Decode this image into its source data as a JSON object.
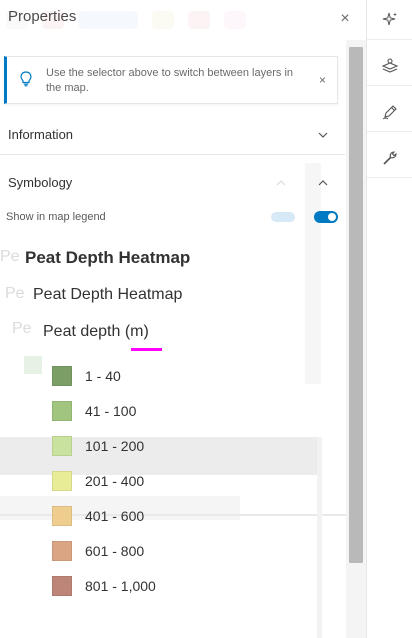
{
  "panel": {
    "title": "Properties",
    "close_glyph": "×"
  },
  "notice": {
    "icon": "lightbulb-icon",
    "text": "Use the selector above to switch between layers in the map.",
    "close_glyph": "×"
  },
  "sections": {
    "information": {
      "label": "Information",
      "state": "collapsed"
    },
    "symbology": {
      "label": "Symbology",
      "state": "expanded"
    }
  },
  "symbology": {
    "show_in_legend_label": "Show in map legend",
    "show_in_legend_on": true,
    "legend_title": "Peat Depth Heatmap",
    "layer_name": "Peat Depth Heatmap",
    "field_label": "Peat depth (m)",
    "classes": [
      {
        "label": "1 - 40",
        "color": "#7a9e63"
      },
      {
        "label": "41 - 100",
        "color": "#a1c47f"
      },
      {
        "label": "101 - 200",
        "color": "#c9e29e"
      },
      {
        "label": "201 - 400",
        "color": "#e9ec97"
      },
      {
        "label": "401 - 600",
        "color": "#efcd8e"
      },
      {
        "label": "601 - 800",
        "color": "#d9a583"
      },
      {
        "label": "801 - 1,000",
        "color": "#bd8577"
      }
    ]
  },
  "ghost": {
    "texts": [
      "Pe",
      "Pe",
      "Pe"
    ]
  },
  "action_bar": {
    "items": [
      {
        "icon": "sparkle-icon"
      },
      {
        "icon": "layer-style-icon"
      },
      {
        "icon": "edit-pencil-icon"
      },
      {
        "icon": "wrench-icon"
      }
    ]
  },
  "colors": {
    "accent": "#007ac2",
    "highlight_underline": "#ff00ff"
  }
}
